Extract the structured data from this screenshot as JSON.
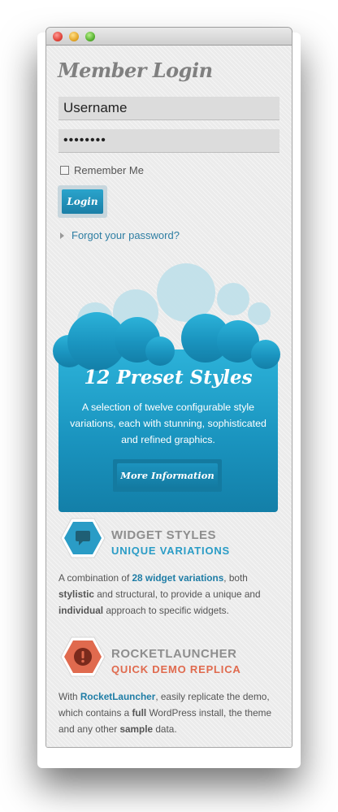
{
  "window": {
    "title": ""
  },
  "login": {
    "title": "Member Login",
    "username_value": "Username",
    "password_value": "••••••••",
    "remember_label": "Remember Me",
    "login_button": "Login",
    "forgot_link": "Forgot your password?"
  },
  "promo": {
    "title": "12 Preset Styles",
    "text": "A selection of twelve configurable style variations, each with stunning, sophisticated and refined graphics.",
    "button": "More Information",
    "color": "#1a8fb8"
  },
  "widgets": {
    "icon": "speech-bubble-icon",
    "title": "WIDGET STYLES",
    "subtitle": "UNIQUE VARIATIONS",
    "subtitle_color": "#2a9cc6",
    "text_1": "A combination of ",
    "text_2": "28 widget variations",
    "text_3": ", both ",
    "text_4": "stylistic",
    "text_5": " and structural, to provide a unique and ",
    "text_6": "individual",
    "text_7": " approach to specific widgets."
  },
  "rocket": {
    "icon": "exclamation-icon",
    "title": "ROCKETLAUNCHER",
    "subtitle": "QUICK DEMO REPLICA",
    "subtitle_color": "#e06a4e",
    "text_1": "With ",
    "text_2": "RocketLauncher",
    "text_3": ", easily replicate the demo, which contains a ",
    "text_4": "full",
    "text_5": " WordPress install, the theme and any other ",
    "text_6": "sample",
    "text_7": " data."
  }
}
